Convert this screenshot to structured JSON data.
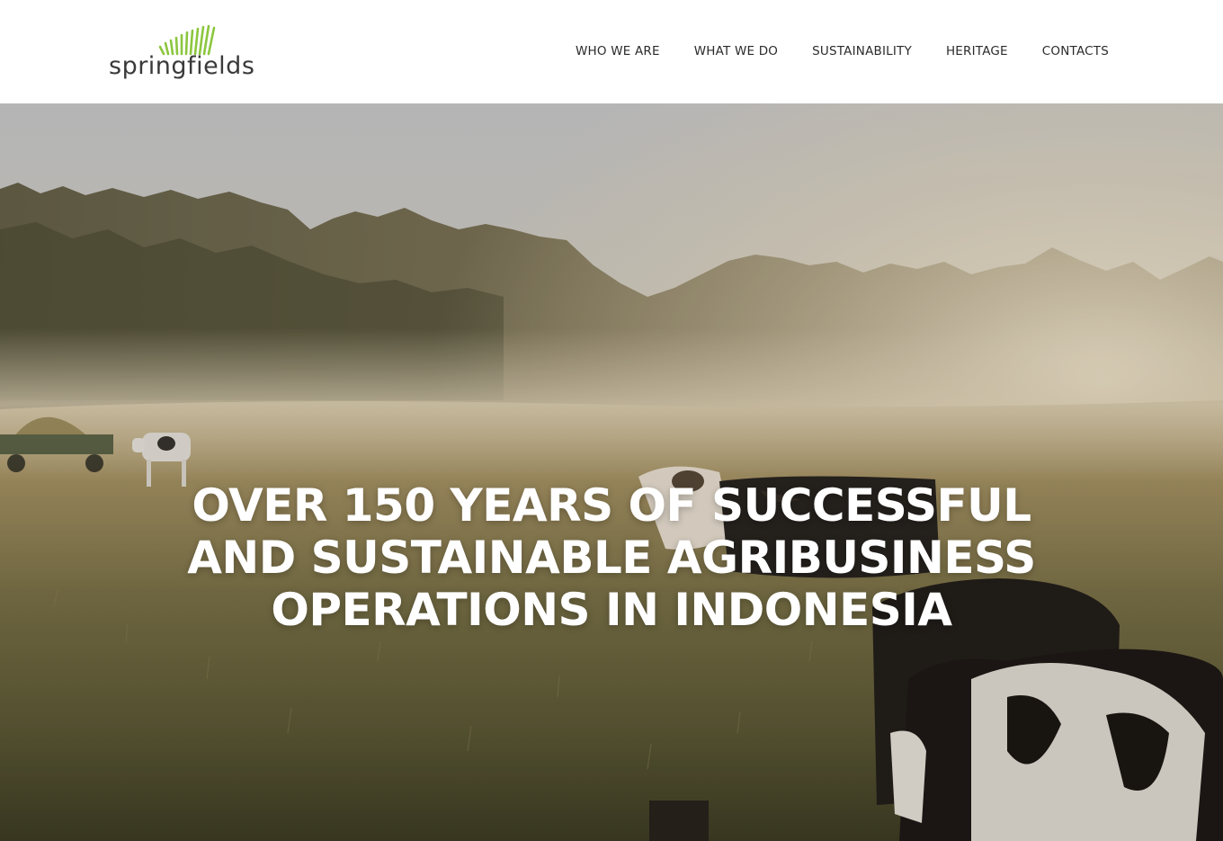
{
  "brand": {
    "logo_text": "springfields",
    "logo_icon": "grass-blades-icon",
    "colors": {
      "logo_text": "#3a3a3a",
      "logo_accent": "#8cc63f"
    }
  },
  "nav": {
    "items": [
      {
        "label": "WHO WE ARE"
      },
      {
        "label": "WHAT WE DO"
      },
      {
        "label": "SUSTAINABILITY"
      },
      {
        "label": "HERITAGE"
      },
      {
        "label": "CONTACTS"
      }
    ]
  },
  "hero": {
    "title_lines": [
      "OVER 150 YEARS OF SUCCESSFUL",
      "AND SUSTAINABLE AGRIBUSINESS",
      "OPERATIONS IN INDONESIA"
    ],
    "background": "misty-pasture-with-cows-photo"
  }
}
